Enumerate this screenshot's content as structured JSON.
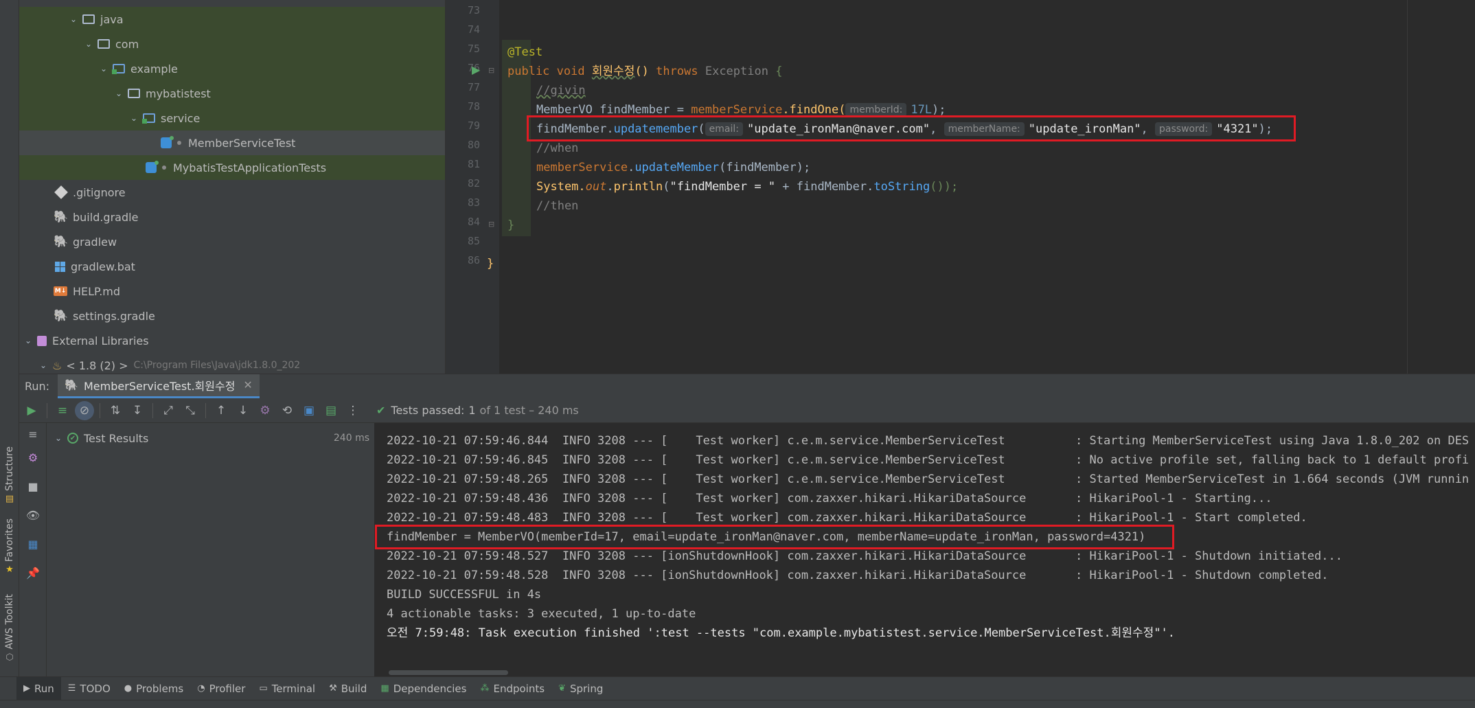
{
  "left_strip": {
    "structure_label": "Structure",
    "favorites_label": "Favorites",
    "aws_label": "AWS Toolkit"
  },
  "project_tree": [
    {
      "label": "java",
      "type": "folder",
      "expanded": true
    },
    {
      "label": "com",
      "type": "folder",
      "expanded": true
    },
    {
      "label": "example",
      "type": "package",
      "expanded": true
    },
    {
      "label": "mybatistest",
      "type": "folder",
      "expanded": true
    },
    {
      "label": "service",
      "type": "package",
      "expanded": true
    },
    {
      "label": "MemberServiceTest",
      "type": "class"
    },
    {
      "label": "MybatisTestApplicationTests",
      "type": "class"
    },
    {
      "label": ".gitignore",
      "type": "git"
    },
    {
      "label": "build.gradle",
      "type": "gradle"
    },
    {
      "label": "gradlew",
      "type": "gradle"
    },
    {
      "label": "gradlew.bat",
      "type": "windows"
    },
    {
      "label": "HELP.md",
      "type": "markdown"
    },
    {
      "label": "settings.gradle",
      "type": "gradle"
    },
    {
      "label": "External Libraries",
      "type": "library",
      "expanded": true
    },
    {
      "label": "< 1.8 (2) >",
      "type": "jdk",
      "path": "C:\\Program Files\\Java\\jdk1.8.0_202"
    }
  ],
  "editor": {
    "line_numbers": [
      "73",
      "74",
      "75",
      "76",
      "77",
      "78",
      "79",
      "80",
      "81",
      "82",
      "83",
      "84",
      "85",
      "86"
    ],
    "code": {
      "l75_annotation": "@Test",
      "l76_public": "public",
      "l76_void": "void",
      "l76_method": "회원수정",
      "l76_parens": "()",
      "l76_throws": "throws",
      "l76_exception": "Exception",
      "l76_brace": "{",
      "l77_comment": "//givin",
      "l78_type": "MemberVO",
      "l78_var": "findMember",
      "l78_eq": "=",
      "l78_service": "memberService",
      "l78_method": ".findOne(",
      "l78_hint": "memberId:",
      "l78_num": "17L",
      "l78_end": ");",
      "l79_var": "findMember.",
      "l79_method": "updatemember",
      "l79_open": "(",
      "l79_hint1": "email:",
      "l79_str1": "\"update_ironMan@naver.com\"",
      "l79_comma1": ",",
      "l79_hint2": "memberName:",
      "l79_str2": "\"update_ironMan\"",
      "l79_comma2": ",",
      "l79_hint3": "password:",
      "l79_str3": "\"4321\"",
      "l79_end": ");",
      "l80_comment": "//when",
      "l81_service": "memberService",
      "l81_dot": ".",
      "l81_method": "updateMember",
      "l81_args": "(findMember);",
      "l82_system": "System.",
      "l82_out": "out",
      "l82_dot": ".",
      "l82_println": "println",
      "l82_open": "(",
      "l82_str": "\"findMember = \"",
      "l82_plus": " + findMember.",
      "l82_tostring": "toString",
      "l82_end": "());",
      "l83_comment": "//then",
      "l84_brace": "}",
      "l86_brace": "}"
    }
  },
  "run_panel": {
    "label": "Run:",
    "tab_label": "MemberServiceTest.회원수정",
    "tests_passed_label": "Tests passed:",
    "tests_passed_count": "1",
    "tests_passed_detail": "of 1 test – 240 ms",
    "test_results_label": "Test Results",
    "test_results_time": "240 ms"
  },
  "console_lines": [
    "2022-10-21 07:59:46.844  INFO 3208 --- [    Test worker] c.e.m.service.MemberServiceTest          : Starting MemberServiceTest using Java 1.8.0_202 on DES",
    "2022-10-21 07:59:46.845  INFO 3208 --- [    Test worker] c.e.m.service.MemberServiceTest          : No active profile set, falling back to 1 default profi",
    "2022-10-21 07:59:48.265  INFO 3208 --- [    Test worker] c.e.m.service.MemberServiceTest          : Started MemberServiceTest in 1.664 seconds (JVM runnin",
    "2022-10-21 07:59:48.436  INFO 3208 --- [    Test worker] com.zaxxer.hikari.HikariDataSource       : HikariPool-1 - Starting...",
    "2022-10-21 07:59:48.483  INFO 3208 --- [    Test worker] com.zaxxer.hikari.HikariDataSource       : HikariPool-1 - Start completed.",
    "findMember = MemberVO(memberId=17, email=update_ironMan@naver.com, memberName=update_ironMan, password=4321)",
    "2022-10-21 07:59:48.527  INFO 3208 --- [ionShutdownHook] com.zaxxer.hikari.HikariDataSource       : HikariPool-1 - Shutdown initiated...",
    "2022-10-21 07:59:48.528  INFO 3208 --- [ionShutdownHook] com.zaxxer.hikari.HikariDataSource       : HikariPool-1 - Shutdown completed.",
    "BUILD SUCCESSFUL in 4s",
    "4 actionable tasks: 3 executed, 1 up-to-date",
    "오전 7:59:48: Task execution finished ':test --tests \"com.example.mybatistest.service.MemberServiceTest.회원수정\"'."
  ],
  "bottom_bar": {
    "run": "Run",
    "todo": "TODO",
    "problems": "Problems",
    "profiler": "Profiler",
    "terminal": "Terminal",
    "build": "Build",
    "dependencies": "Dependencies",
    "endpoints": "Endpoints",
    "spring": "Spring"
  },
  "colors": {
    "highlight_box": "#e01b24",
    "accent_green": "#59a869",
    "tab_underline": "#4a88c7"
  }
}
